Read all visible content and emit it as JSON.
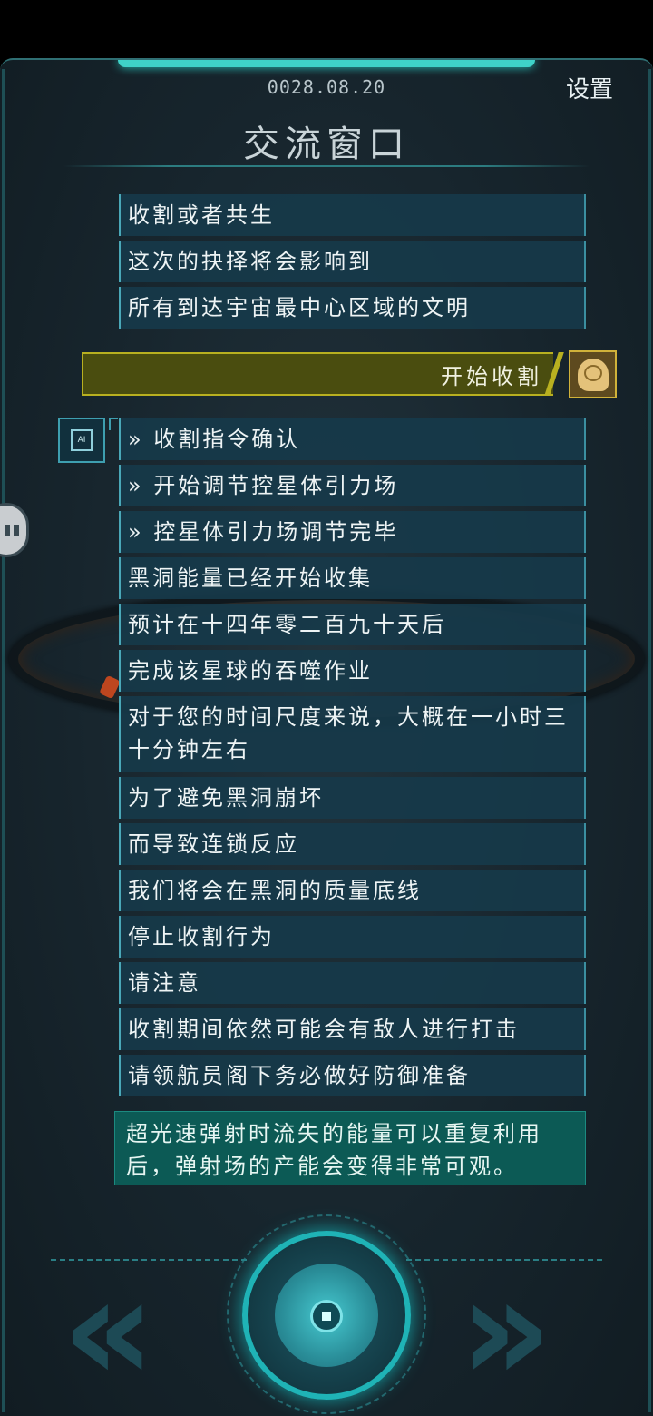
{
  "header": {
    "date": "0028.08.20",
    "settings_label": "设置",
    "title": "交流窗口"
  },
  "messages_top": [
    "收割或者共生",
    "这次的抉择将会影响到",
    "所有到达宇宙最中心区域的文明"
  ],
  "player_choice": "开始收割",
  "ai_badge_label": "AI",
  "messages_ai": [
    "» 收割指令确认",
    "» 开始调节控星体引力场",
    "» 控星体引力场调节完毕",
    "黑洞能量已经开始收集",
    "预计在十四年零二百九十天后",
    "完成该星球的吞噬作业",
    "对于您的时间尺度来说，大概在一小时三十分钟左右",
    "为了避免黑洞崩坏",
    "而导致连锁反应",
    "我们将会在黑洞的质量底线",
    "停止收割行为",
    "请注意",
    "收割期间依然可能会有敌人进行打击",
    "请领航员阁下务必做好防御准备"
  ],
  "hint_text": "超光速弹射时流失的能量可以重复利用后，弹射场的产能会变得非常可观。",
  "nav": {
    "prev_glyph": "«",
    "next_glyph": "»"
  },
  "colors": {
    "accent": "#1fb3b6",
    "message_bg": "#163a4a",
    "choice_bg": "#4a4d0f",
    "choice_border": "#b8b020",
    "hint_bg": "#0c5a55"
  }
}
